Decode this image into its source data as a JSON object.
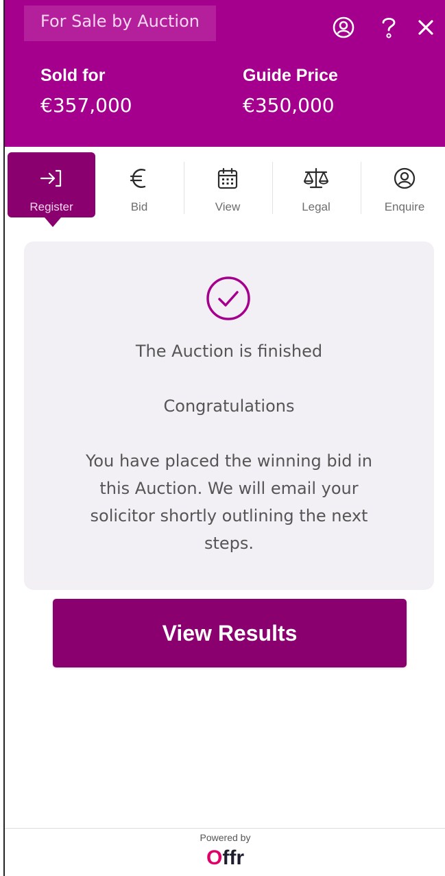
{
  "header": {
    "sale_type": "For Sale by Auction",
    "sold_label": "Sold for",
    "sold_value": "€357,000",
    "guide_label": "Guide Price",
    "guide_value": "€350,000",
    "icons": [
      "account-icon",
      "help-icon",
      "close-icon"
    ]
  },
  "tabs": [
    {
      "label": "Register",
      "icon": "register-icon",
      "active": true
    },
    {
      "label": "Bid",
      "icon": "euro-icon",
      "active": false
    },
    {
      "label": "View",
      "icon": "calendar-icon",
      "active": false
    },
    {
      "label": "Legal",
      "icon": "scales-icon",
      "active": false
    },
    {
      "label": "Enquire",
      "icon": "user-circle-icon",
      "active": false
    }
  ],
  "status": {
    "icon": "check-circle-icon",
    "title": "The Auction is finished",
    "congrats": "Congratulations",
    "message_lines": [
      "You have placed the winning bid in",
      "this Auction. We will email your",
      "solicitor shortly outlining the next",
      "steps."
    ]
  },
  "action": {
    "button_label": "View Results"
  },
  "footer": {
    "powered_by": "Powered by",
    "brand_first": "O",
    "brand_rest": "ffr"
  },
  "colors": {
    "brand": "#a4008d",
    "brand_dark": "#8b006f",
    "card_bg": "#f2f0f5",
    "logo_accent": "#e0006a"
  }
}
